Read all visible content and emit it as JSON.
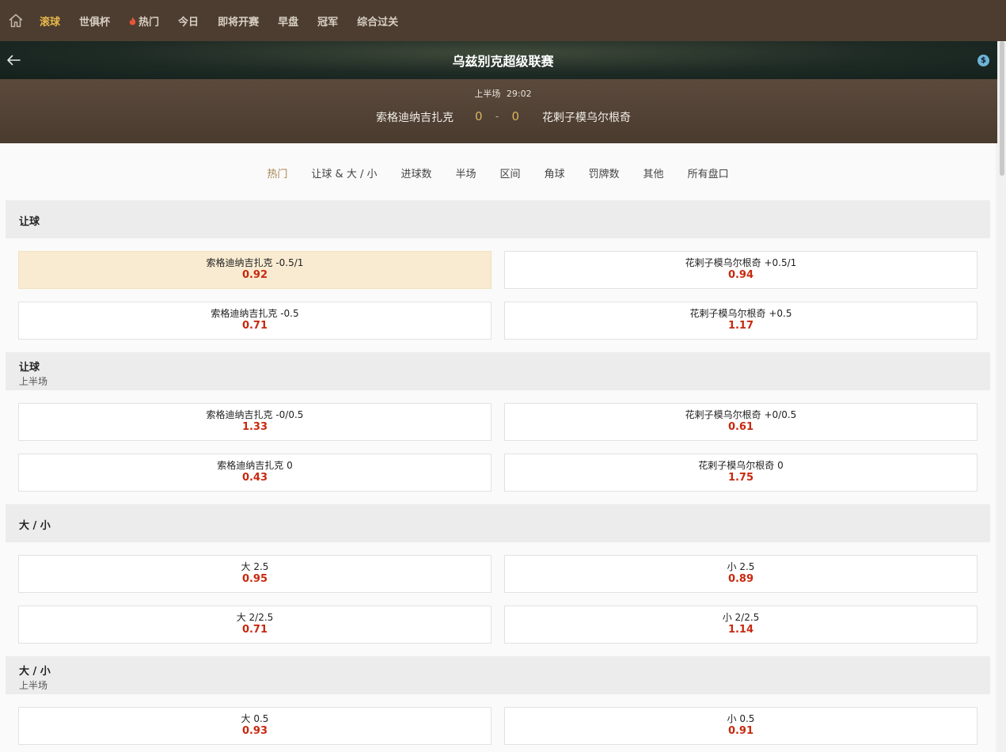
{
  "nav": {
    "items": [
      {
        "label": "滚球",
        "active": true
      },
      {
        "label": "世俱杯"
      },
      {
        "label": "热门",
        "icon": "fire-icon"
      },
      {
        "label": "今日"
      },
      {
        "label": "即将开赛"
      },
      {
        "label": "早盘"
      },
      {
        "label": "冠军"
      },
      {
        "label": "综合过关"
      }
    ]
  },
  "match": {
    "league": "乌兹别克超级联赛",
    "period": "上半场",
    "clock": "29:02",
    "home_team": "索格迪纳吉扎克",
    "away_team": "花剌子模乌尔根奇",
    "home_score": "0",
    "score_sep": "-",
    "away_score": "0"
  },
  "tabs": [
    "热门",
    "让球 & 大 / 小",
    "进球数",
    "半场",
    "区间",
    "角球",
    "罚牌数",
    "其他",
    "所有盘口"
  ],
  "active_tab": "热门",
  "colors": {
    "odds": "#c8290f",
    "accent": "#e8b84b",
    "selected_bg": "#f9ebd1",
    "nav_bg": "#4d3d30"
  },
  "sections": [
    {
      "title": "让球",
      "subtitle": "",
      "rows": [
        {
          "left": {
            "label": "索格迪纳吉扎克 -0.5/1",
            "odds": "0.92",
            "selected": true
          },
          "right": {
            "label": "花剌子模乌尔根奇 +0.5/1",
            "odds": "0.94"
          }
        },
        {
          "left": {
            "label": "索格迪纳吉扎克 -0.5",
            "odds": "0.71"
          },
          "right": {
            "label": "花剌子模乌尔根奇 +0.5",
            "odds": "1.17"
          }
        }
      ]
    },
    {
      "title": "让球",
      "subtitle": "上半场",
      "rows": [
        {
          "left": {
            "label": "索格迪纳吉扎克 -0/0.5",
            "odds": "1.33"
          },
          "right": {
            "label": "花剌子模乌尔根奇 +0/0.5",
            "odds": "0.61"
          }
        },
        {
          "left": {
            "label": "索格迪纳吉扎克 0",
            "odds": "0.43"
          },
          "right": {
            "label": "花剌子模乌尔根奇 0",
            "odds": "1.75"
          }
        }
      ]
    },
    {
      "title": "大 / 小",
      "subtitle": "",
      "rows": [
        {
          "left": {
            "label": "大 2.5",
            "odds": "0.95"
          },
          "right": {
            "label": "小 2.5",
            "odds": "0.89"
          }
        },
        {
          "left": {
            "label": "大 2/2.5",
            "odds": "0.71"
          },
          "right": {
            "label": "小 2/2.5",
            "odds": "1.14"
          }
        }
      ]
    },
    {
      "title": "大 / 小",
      "subtitle": "上半场",
      "rows": [
        {
          "left": {
            "label": "大 0.5",
            "odds": "0.93"
          },
          "right": {
            "label": "小 0.5",
            "odds": "0.91"
          }
        }
      ]
    }
  ]
}
